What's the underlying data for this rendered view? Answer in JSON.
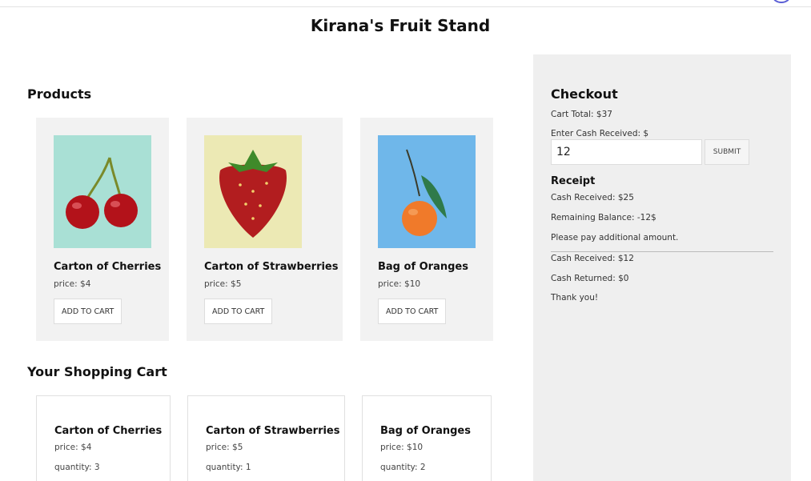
{
  "site": {
    "title": "Kirana's Fruit Stand"
  },
  "products": {
    "heading": "Products",
    "items": [
      {
        "name": "Carton of Cherries",
        "price": "price: $4",
        "button": "ADD TO CART",
        "image": "cherries-image"
      },
      {
        "name": "Carton of Strawberries",
        "price": "price: $5",
        "button": "ADD TO CART",
        "image": "strawberry-image"
      },
      {
        "name": "Bag of Oranges",
        "price": "price: $10",
        "button": "ADD TO CART",
        "image": "orange-image"
      }
    ]
  },
  "cart": {
    "heading": "Your Shopping Cart",
    "items": [
      {
        "name": "Carton of Cherries",
        "price": "price: $4",
        "quantity": "quantity: 3"
      },
      {
        "name": "Carton of Strawberries",
        "price": "price: $5",
        "quantity": "quantity: 1"
      },
      {
        "name": "Bag of Oranges",
        "price": "price: $10",
        "quantity": "quantity: 2"
      }
    ]
  },
  "checkout": {
    "heading": "Checkout",
    "cart_total": "Cart Total: $37",
    "cash_label": "Enter Cash Received: $",
    "cash_value": "12",
    "submit_label": "SUBMIT",
    "receipt": {
      "heading": "Receipt",
      "lines_before": [
        "Cash Received: $25",
        "Remaining Balance: -12$",
        "Please pay additional amount."
      ],
      "lines_after": [
        "Cash Received: $12",
        "Cash Returned: $0",
        "Thank you!"
      ]
    }
  },
  "colors": {
    "panel": "#efefef",
    "card": "#f2f2f2",
    "cherry_bg": "#a9e0d5",
    "strawberry_bg": "#ece9b4",
    "orange_bg": "#6fb7ea"
  }
}
